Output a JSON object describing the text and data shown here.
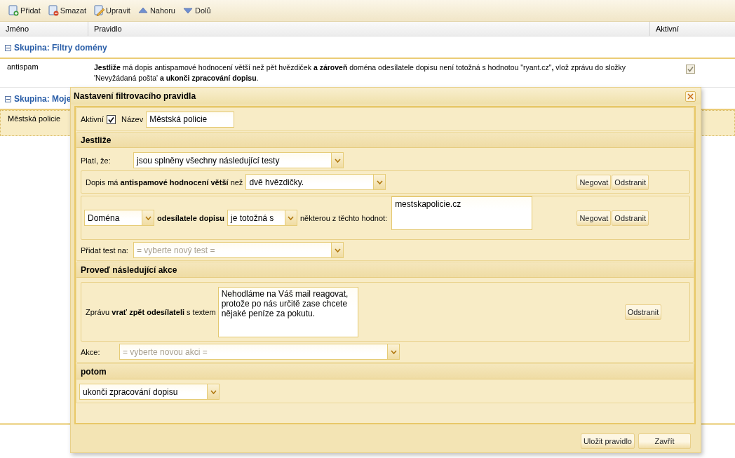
{
  "toolbar": [
    {
      "kind": "add",
      "label": "Přidat"
    },
    {
      "kind": "delete",
      "label": "Smazat"
    },
    {
      "kind": "edit",
      "label": "Upravit"
    },
    {
      "kind": "up",
      "label": "Nahoru"
    },
    {
      "kind": "down",
      "label": "Dolů"
    }
  ],
  "table": {
    "columns": [
      "Jméno",
      "Pravidlo",
      "Aktivní"
    ],
    "groups": [
      {
        "title": "Skupina: Filtry domény",
        "expanded": true,
        "rows": [
          {
            "name": "antispam",
            "rule": "**Jestliže** má dopis antispamové hodnocení větší než pět hvězdiček **a zároveň** doména odesílatele dopisu není totožná s hodnotou \"ryant.cz\"**,** vlož zprávu do složky 'Nevyžádaná pošta' **a ukonči zpracování dopisu**.",
            "active": true,
            "selected": false
          }
        ]
      },
      {
        "title": "Skupina: Moje",
        "expanded": true,
        "rows": [
          {
            "name": "Městská policie",
            "selected": true
          }
        ]
      }
    ]
  },
  "dialog": {
    "title": "Nastavení filtrovacího pravidla",
    "active": {
      "label": "Aktivní",
      "checked": true
    },
    "name": {
      "label": "Název",
      "value": "Městská policie"
    },
    "conditions": {
      "title": "Jestliže",
      "match_label": "Platí, že:",
      "match_value": "jsou splněny všechny následující testy",
      "tests": [
        {
          "kind": "rating",
          "text": "Dopis má **antispamové hodnocení větší** než",
          "value": "dvě hvězdičky.",
          "buttons": [
            "Negovat",
            "Odstranit"
          ]
        },
        {
          "kind": "domain",
          "field": "Doména",
          "label": "odesílatele dopisu",
          "operator": "je totožná s",
          "suffix": "některou z těchto hodnot:",
          "values": "mestskapolicie.cz",
          "buttons": [
            "Negovat",
            "Odstranit"
          ]
        }
      ],
      "add_label": "Přidat test na:",
      "add_placeholder": "= vyberte nový test ="
    },
    "actions": {
      "title": "Proveď následující akce",
      "items": [
        {
          "text": "Zprávu **vrať zpět odesílateli** s textem",
          "message": "Nehodláme na Váš mail reagovat, protože po nás určitě zase chcete nějaké peníze za pokutu.",
          "button": "Odstranit"
        }
      ],
      "add_label": "Akce:",
      "add_placeholder": "= vyberte novou akci ="
    },
    "then": {
      "title": "potom",
      "value": "ukonči zpracování dopisu"
    },
    "buttons": [
      "Uložit pravidlo",
      "Zavřít"
    ]
  }
}
